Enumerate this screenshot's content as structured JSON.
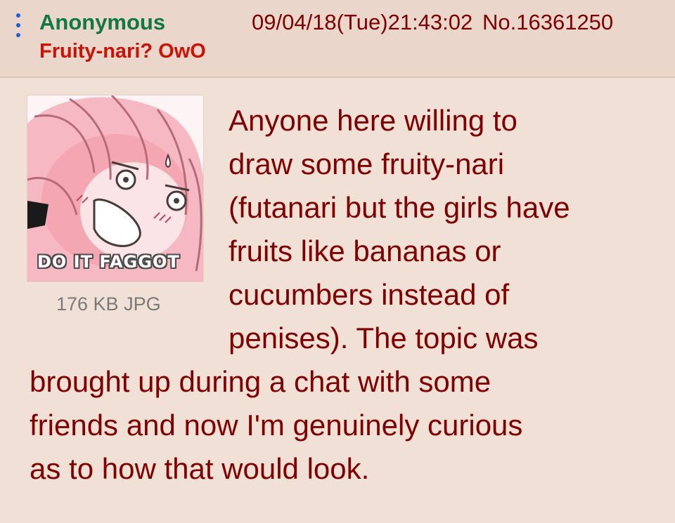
{
  "post": {
    "name": "Anonymous",
    "subject": "Fruity-nari? OwO",
    "datetime": "09/04/18(Tue)21:43:02",
    "number": "No.16361250",
    "image": {
      "caption": "DO IT FAGGOT",
      "info": "176 KB JPG"
    },
    "comment_lines": [
      "Anyone here willing to",
      "draw some fruity-nari",
      "(futanari but the girls have",
      "fruits like bananas or",
      "cucumbers instead of",
      "penises). The topic was",
      "brought up during a chat with some",
      "friends and now I'm genuinely curious",
      "as to how that would look."
    ]
  },
  "icons": {
    "menu": "vertical-dots-icon"
  },
  "colors": {
    "background": "#f0e0d6",
    "header": "#ead6ca",
    "name": "#117743",
    "subject": "#cc1105",
    "text": "#800000",
    "menu": "#1f5fd8"
  }
}
